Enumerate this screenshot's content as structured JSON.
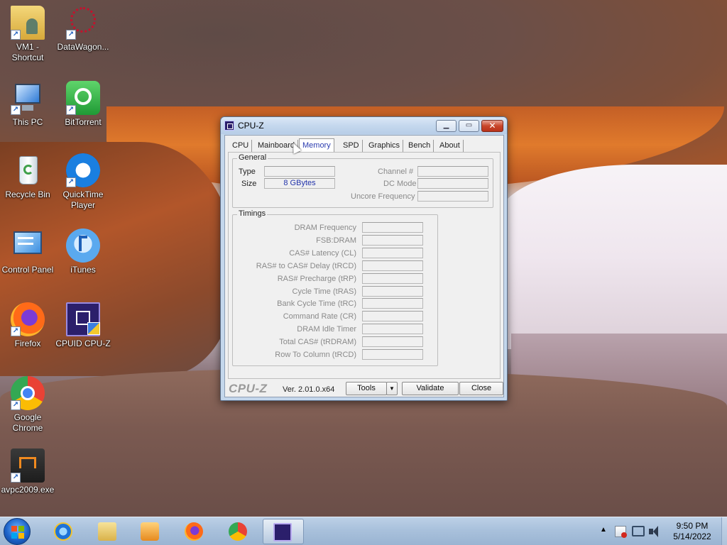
{
  "desktop": {
    "icons": [
      {
        "label": "VM1 -\nShortcut",
        "icon": "folder-user-icon"
      },
      {
        "label": "DataWagon...",
        "icon": "datawagon-icon"
      },
      {
        "label": "This PC",
        "icon": "computer-icon"
      },
      {
        "label": "BitTorrent",
        "icon": "bittorrent-icon"
      },
      {
        "label": "Recycle Bin",
        "icon": "recycle-bin-icon"
      },
      {
        "label": "QuickTime\nPlayer",
        "icon": "quicktime-icon"
      },
      {
        "label": "Control Panel",
        "icon": "control-panel-icon"
      },
      {
        "label": "iTunes",
        "icon": "itunes-icon"
      },
      {
        "label": "Firefox",
        "icon": "firefox-icon"
      },
      {
        "label": "CPUID CPU-Z",
        "icon": "cpuz-icon"
      },
      {
        "label": "Google\nChrome",
        "icon": "chrome-icon"
      },
      {
        "label": "avpc2009.exe",
        "icon": "installer-icon"
      }
    ]
  },
  "window": {
    "title": "CPU-Z",
    "tabs": [
      "CPU",
      "Mainboard",
      "Memory",
      "SPD",
      "Graphics",
      "Bench",
      "About"
    ],
    "active_tab": "Memory",
    "general": {
      "legend": "General",
      "type_label": "Type",
      "type_value": "",
      "size_label": "Size",
      "size_value": "8 GBytes",
      "channel_label": "Channel #",
      "channel_value": "",
      "dc_mode_label": "DC Mode",
      "dc_mode_value": "",
      "uncore_label": "Uncore Frequency",
      "uncore_value": ""
    },
    "timings": {
      "legend": "Timings",
      "rows": [
        {
          "label": "DRAM Frequency",
          "value": ""
        },
        {
          "label": "FSB:DRAM",
          "value": ""
        },
        {
          "label": "CAS# Latency (CL)",
          "value": ""
        },
        {
          "label": "RAS# to CAS# Delay (tRCD)",
          "value": ""
        },
        {
          "label": "RAS# Precharge (tRP)",
          "value": ""
        },
        {
          "label": "Cycle Time (tRAS)",
          "value": ""
        },
        {
          "label": "Bank Cycle Time (tRC)",
          "value": ""
        },
        {
          "label": "Command Rate (CR)",
          "value": ""
        },
        {
          "label": "DRAM Idle Timer",
          "value": ""
        },
        {
          "label": "Total CAS# (tRDRAM)",
          "value": ""
        },
        {
          "label": "Row To Column (tRCD)",
          "value": ""
        }
      ]
    },
    "footer": {
      "brand": "CPU-Z",
      "version": "Ver. 2.01.0.x64",
      "tools_label": "Tools",
      "tools_arrow": "▼",
      "validate_label": "Validate",
      "close_label": "Close"
    }
  },
  "taskbar": {
    "clock_time": "9:50 PM",
    "clock_date": "5/14/2022",
    "tray_arrow": "▲"
  },
  "colors": {
    "accent_blue": "#2b3cb0",
    "title_gradient_top": "#dbe8f6",
    "close_red": "#c9462a"
  }
}
